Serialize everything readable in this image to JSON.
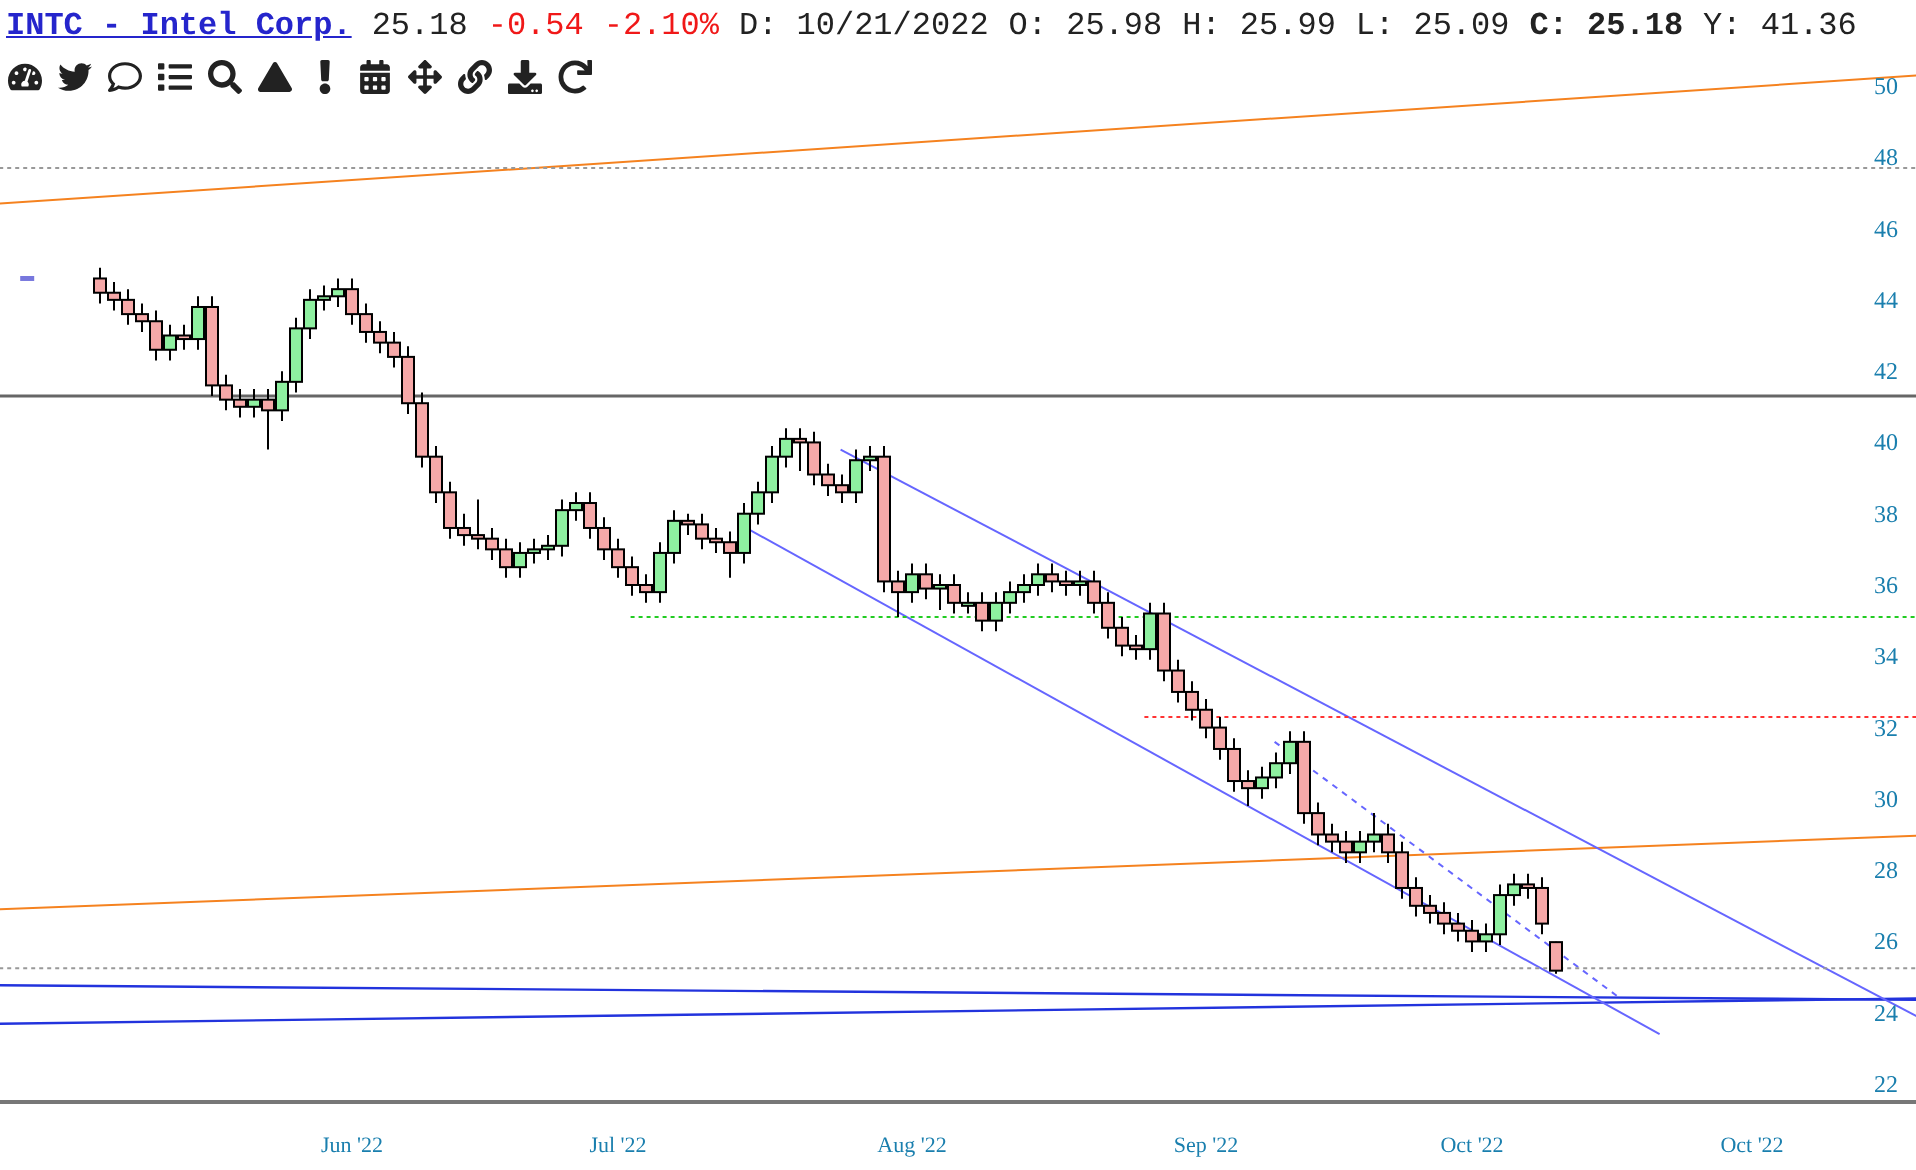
{
  "quote": {
    "symbol_link": "INTC - Intel Corp.",
    "price": "25.18",
    "change": "-0.54",
    "change_percent": "-2.10%",
    "date": "D: 10/21/2022",
    "open": "O: 25.98",
    "high": "H: 25.99",
    "low": "L: 25.09",
    "close": "C: 25.18",
    "year": "Y: 41.36"
  },
  "chart": {
    "chart_data": {
      "type": "candlestick",
      "ylim": [
        22,
        50
      ],
      "yticks": [
        22,
        24,
        26,
        28,
        30,
        32,
        34,
        36,
        38,
        40,
        42,
        44,
        46,
        48,
        50
      ],
      "categories": [
        null,
        null,
        null,
        null,
        null,
        null,
        null,
        null,
        null,
        null,
        null,
        null,
        null,
        null,
        null,
        null,
        null,
        null,
        "Jun '22",
        null,
        null,
        null,
        null,
        null,
        null,
        null,
        null,
        null,
        null,
        null,
        null,
        null,
        null,
        null,
        null,
        null,
        null,
        "Jul '22",
        null,
        null,
        null,
        null,
        null,
        null,
        null,
        null,
        null,
        null,
        null,
        null,
        null,
        null,
        null,
        null,
        null,
        null,
        null,
        null,
        "Aug '22",
        null,
        null,
        null,
        null,
        null,
        null,
        null,
        null,
        null,
        null,
        null,
        null,
        null,
        null,
        null,
        null,
        null,
        null,
        null,
        null,
        "Sep '22",
        null,
        null,
        null,
        null,
        null,
        null,
        null,
        null,
        null,
        null,
        null,
        null,
        null,
        null,
        null,
        null,
        null,
        null,
        "Oct '22",
        null,
        null,
        null,
        null,
        null,
        null,
        null,
        null,
        null,
        null,
        null,
        null,
        null,
        null,
        null,
        null,
        null,
        null,
        null,
        "Oct '22",
        null,
        null,
        null,
        null
      ],
      "ohlc": [
        [
          44.6,
          44.9,
          43.9,
          44.2
        ],
        [
          44.2,
          44.5,
          43.7,
          44.0
        ],
        [
          44.0,
          44.3,
          43.3,
          43.6
        ],
        [
          43.6,
          43.9,
          43.1,
          43.4
        ],
        [
          43.4,
          43.7,
          42.3,
          42.6
        ],
        [
          42.6,
          43.3,
          42.3,
          43.0
        ],
        [
          43.0,
          43.3,
          42.6,
          42.9
        ],
        [
          42.9,
          44.1,
          42.6,
          43.8
        ],
        [
          43.8,
          44.1,
          41.3,
          41.6
        ],
        [
          41.6,
          41.9,
          40.9,
          41.2
        ],
        [
          41.2,
          41.5,
          40.7,
          41.0
        ],
        [
          41.0,
          41.5,
          40.7,
          41.2
        ],
        [
          41.2,
          41.5,
          39.8,
          40.9
        ],
        [
          40.9,
          42.0,
          40.6,
          41.7
        ],
        [
          41.7,
          43.5,
          41.4,
          43.2
        ],
        [
          43.2,
          44.3,
          42.9,
          44.0
        ],
        [
          44.0,
          44.4,
          43.7,
          44.1
        ],
        [
          44.1,
          44.6,
          43.8,
          44.3
        ],
        [
          44.3,
          44.6,
          43.3,
          43.6
        ],
        [
          43.6,
          43.9,
          42.8,
          43.1
        ],
        [
          43.1,
          43.4,
          42.5,
          42.8
        ],
        [
          42.8,
          43.1,
          42.1,
          42.4
        ],
        [
          42.4,
          42.7,
          40.8,
          41.1
        ],
        [
          41.1,
          41.4,
          39.3,
          39.6
        ],
        [
          39.6,
          39.9,
          38.3,
          38.6
        ],
        [
          38.6,
          38.9,
          37.3,
          37.6
        ],
        [
          37.6,
          38.0,
          37.1,
          37.4
        ],
        [
          37.4,
          38.4,
          37.0,
          37.3
        ],
        [
          37.3,
          37.6,
          36.7,
          37.0
        ],
        [
          37.0,
          37.3,
          36.2,
          36.5
        ],
        [
          36.5,
          37.2,
          36.2,
          36.9
        ],
        [
          36.9,
          37.3,
          36.6,
          37.0
        ],
        [
          37.0,
          37.4,
          36.7,
          37.1
        ],
        [
          37.1,
          38.4,
          36.8,
          38.1
        ],
        [
          38.1,
          38.6,
          37.8,
          38.3
        ],
        [
          38.3,
          38.6,
          37.3,
          37.6
        ],
        [
          37.6,
          37.9,
          36.7,
          37.0
        ],
        [
          37.0,
          37.3,
          36.2,
          36.5
        ],
        [
          36.5,
          36.8,
          35.7,
          36.0
        ],
        [
          36.0,
          36.3,
          35.5,
          35.8
        ],
        [
          35.8,
          37.2,
          35.5,
          36.9
        ],
        [
          36.9,
          38.1,
          36.6,
          37.8
        ],
        [
          37.8,
          38.0,
          37.4,
          37.7
        ],
        [
          37.7,
          38.0,
          37.0,
          37.3
        ],
        [
          37.3,
          37.6,
          36.9,
          37.2
        ],
        [
          37.2,
          37.5,
          36.2,
          36.9
        ],
        [
          36.9,
          38.3,
          36.6,
          38.0
        ],
        [
          38.0,
          38.9,
          37.7,
          38.6
        ],
        [
          38.6,
          39.9,
          38.3,
          39.6
        ],
        [
          39.6,
          40.4,
          39.3,
          40.1
        ],
        [
          40.1,
          40.4,
          39.2,
          40.0
        ],
        [
          40.0,
          40.3,
          38.8,
          39.1
        ],
        [
          39.1,
          39.4,
          38.5,
          38.8
        ],
        [
          38.8,
          39.1,
          38.3,
          38.6
        ],
        [
          38.6,
          39.8,
          38.3,
          39.5
        ],
        [
          39.5,
          39.9,
          39.2,
          39.6
        ],
        [
          39.6,
          39.9,
          35.8,
          36.1
        ],
        [
          36.1,
          36.4,
          35.1,
          35.8
        ],
        [
          35.8,
          36.6,
          35.5,
          36.3
        ],
        [
          36.3,
          36.6,
          35.6,
          35.9
        ],
        [
          35.9,
          36.3,
          35.3,
          36.0
        ],
        [
          36.0,
          36.3,
          35.2,
          35.5
        ],
        [
          35.5,
          35.8,
          35.2,
          35.5
        ],
        [
          35.5,
          35.8,
          34.7,
          35.0
        ],
        [
          35.0,
          35.8,
          34.7,
          35.5
        ],
        [
          35.5,
          36.1,
          35.2,
          35.8
        ],
        [
          35.8,
          36.3,
          35.5,
          36.0
        ],
        [
          36.0,
          36.6,
          35.7,
          36.3
        ],
        [
          36.3,
          36.6,
          35.8,
          36.1
        ],
        [
          36.1,
          36.4,
          35.7,
          36.0
        ],
        [
          36.0,
          36.4,
          35.7,
          36.1
        ],
        [
          36.1,
          36.4,
          35.2,
          35.5
        ],
        [
          35.5,
          35.8,
          34.5,
          34.8
        ],
        [
          34.8,
          35.1,
          34.0,
          34.3
        ],
        [
          34.3,
          34.6,
          33.9,
          34.2
        ],
        [
          34.2,
          35.5,
          33.9,
          35.2
        ],
        [
          35.2,
          35.5,
          33.3,
          33.6
        ],
        [
          33.6,
          33.9,
          32.7,
          33.0
        ],
        [
          33.0,
          33.3,
          32.2,
          32.5
        ],
        [
          32.5,
          32.8,
          31.7,
          32.0
        ],
        [
          32.0,
          32.3,
          31.1,
          31.4
        ],
        [
          31.4,
          31.7,
          30.2,
          30.5
        ],
        [
          30.5,
          30.8,
          29.8,
          30.3
        ],
        [
          30.3,
          30.9,
          30.0,
          30.6
        ],
        [
          30.6,
          31.3,
          30.3,
          31.0
        ],
        [
          31.0,
          31.9,
          30.7,
          31.6
        ],
        [
          31.6,
          31.9,
          29.3,
          29.6
        ],
        [
          29.6,
          29.9,
          28.7,
          29.0
        ],
        [
          29.0,
          29.3,
          28.5,
          28.8
        ],
        [
          28.8,
          29.1,
          28.2,
          28.5
        ],
        [
          28.5,
          29.1,
          28.2,
          28.8
        ],
        [
          28.8,
          29.6,
          28.5,
          29.0
        ],
        [
          29.0,
          29.3,
          28.2,
          28.5
        ],
        [
          28.5,
          28.8,
          27.2,
          27.5
        ],
        [
          27.5,
          27.8,
          26.7,
          27.0
        ],
        [
          27.0,
          27.3,
          26.5,
          26.8
        ],
        [
          26.8,
          27.1,
          26.2,
          26.5
        ],
        [
          26.5,
          26.8,
          26.0,
          26.3
        ],
        [
          26.3,
          26.6,
          25.7,
          26.0
        ],
        [
          26.0,
          26.5,
          25.7,
          26.2
        ],
        [
          26.2,
          27.6,
          25.9,
          27.3
        ],
        [
          27.3,
          27.9,
          27.0,
          27.6
        ],
        [
          27.6,
          27.9,
          27.2,
          27.5
        ],
        [
          27.5,
          27.8,
          26.2,
          26.5
        ],
        [
          25.98,
          25.99,
          25.09,
          25.18
        ],
        null,
        null,
        null,
        null,
        null,
        null,
        null,
        null,
        null,
        null,
        null,
        null,
        null,
        null,
        null,
        null,
        null,
        null
      ]
    }
  }
}
